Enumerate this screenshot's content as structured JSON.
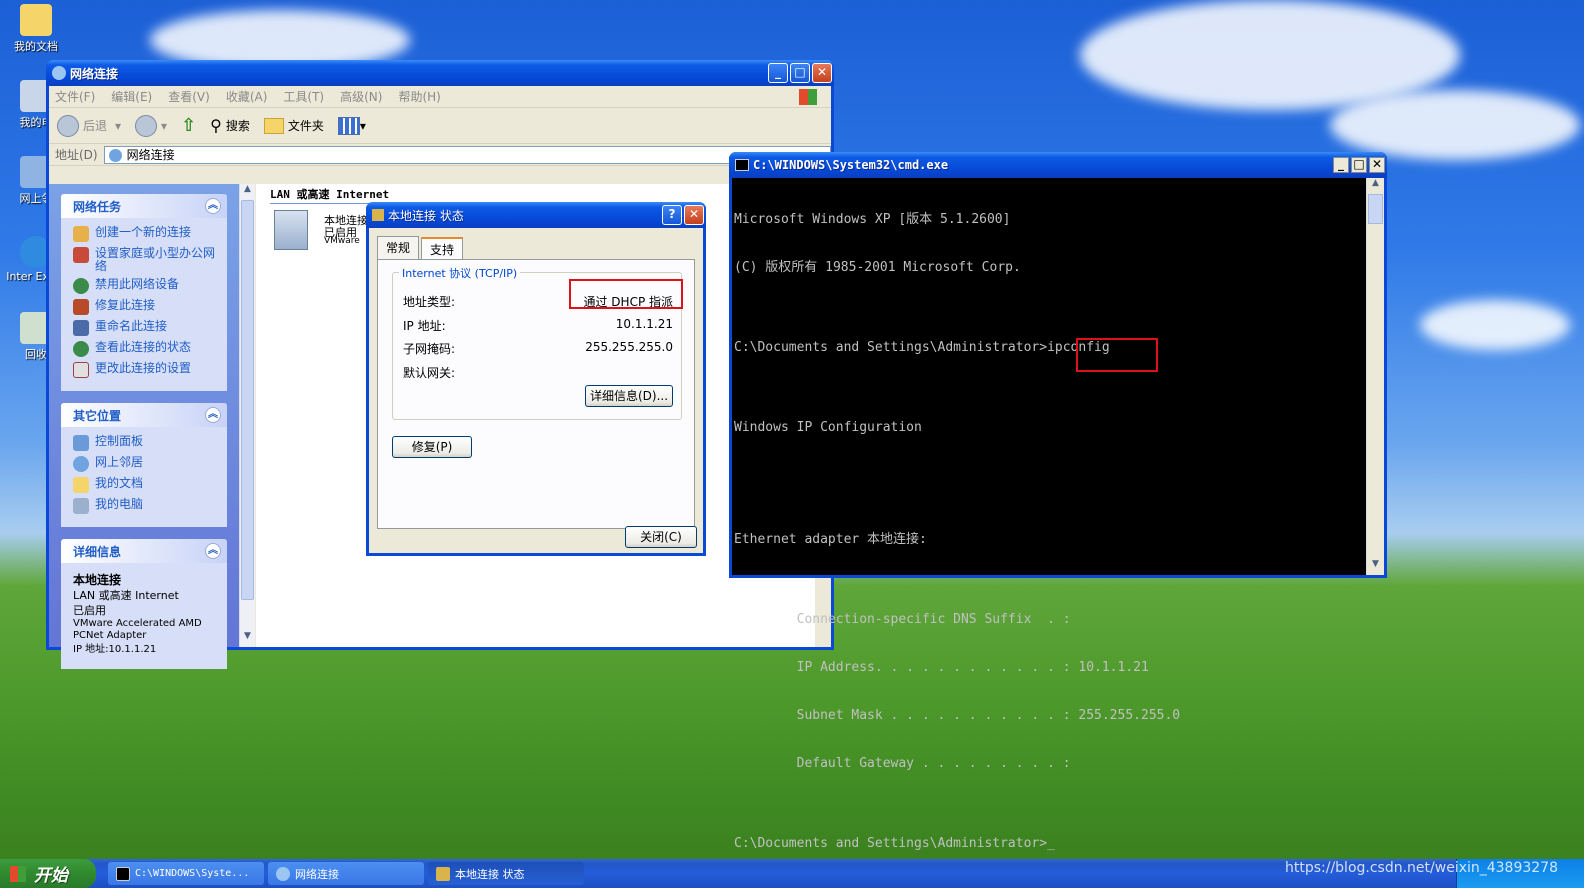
{
  "desktop": {
    "icons": [
      {
        "label": "我的文档"
      },
      {
        "label": "我的电"
      },
      {
        "label": "网上邻"
      },
      {
        "label": "Inter Explo"
      },
      {
        "label": "回收"
      }
    ]
  },
  "explorer": {
    "title": "网络连接",
    "menu": [
      "文件(F)",
      "编辑(E)",
      "查看(V)",
      "收藏(A)",
      "工具(T)",
      "高级(N)",
      "帮助(H)"
    ],
    "toolbar": {
      "back": "后退",
      "search": "搜索",
      "folders": "文件夹"
    },
    "address_label": "地址(D)",
    "address_value": "网络连接",
    "group_header": "LAN 或高速 Internet",
    "item": {
      "name": "本地连接",
      "status": "已启用",
      "device": "VMware"
    },
    "tasks": {
      "title": "网络任务",
      "items": [
        "创建一个新的连接",
        "设置家庭或小型办公网络",
        "禁用此网络设备",
        "修复此连接",
        "重命名此连接",
        "查看此连接的状态",
        "更改此连接的设置"
      ]
    },
    "places": {
      "title": "其它位置",
      "items": [
        "控制面板",
        "网上邻居",
        "我的文档",
        "我的电脑"
      ]
    },
    "details": {
      "title": "详细信息",
      "name": "本地连接",
      "type": "LAN 或高速 Internet",
      "status": "已启用",
      "device": "VMware Accelerated AMD PCNet Adapter",
      "ip": "IP 地址:10.1.1.21"
    }
  },
  "status_dialog": {
    "title": "本地连接 状态",
    "tabs": [
      "常规",
      "支持"
    ],
    "group_label": "Internet 协议 (TCP/IP)",
    "rows": [
      {
        "label": "地址类型:",
        "value": "通过 DHCP 指派"
      },
      {
        "label": "IP 地址:",
        "value": "10.1.1.21"
      },
      {
        "label": "子网掩码:",
        "value": "255.255.255.0"
      },
      {
        "label": "默认网关:",
        "value": ""
      }
    ],
    "details_button": "详细信息(D)...",
    "repair_button": "修复(P)",
    "close_button": "关闭(C)"
  },
  "cmd": {
    "title": "C:\\WINDOWS\\System32\\cmd.exe",
    "lines": [
      "Microsoft Windows XP [版本 5.1.2600]",
      "(C) 版权所有 1985-2001 Microsoft Corp.",
      "",
      "C:\\Documents and Settings\\Administrator>ipconfig",
      "",
      "Windows IP Configuration",
      "",
      "",
      "Ethernet adapter 本地连接:",
      "",
      "        Connection-specific DNS Suffix  . :",
      "        IP Address. . . . . . . . . . . . : 10.1.1.21",
      "        Subnet Mask . . . . . . . . . . . : 255.255.255.0",
      "        Default Gateway . . . . . . . . . :",
      "",
      "C:\\Documents and Settings\\Administrator>_"
    ]
  },
  "taskbar": {
    "start": "开始",
    "tasks": [
      "C:\\WINDOWS\\Syste...",
      "网络连接",
      "本地连接 状态"
    ],
    "watermark": "https://blog.csdn.net/weixin_43893278"
  },
  "colors": {
    "xp_blue": "#0a48d8",
    "highlight_red": "#e0101a",
    "link_blue": "#215dc6"
  }
}
